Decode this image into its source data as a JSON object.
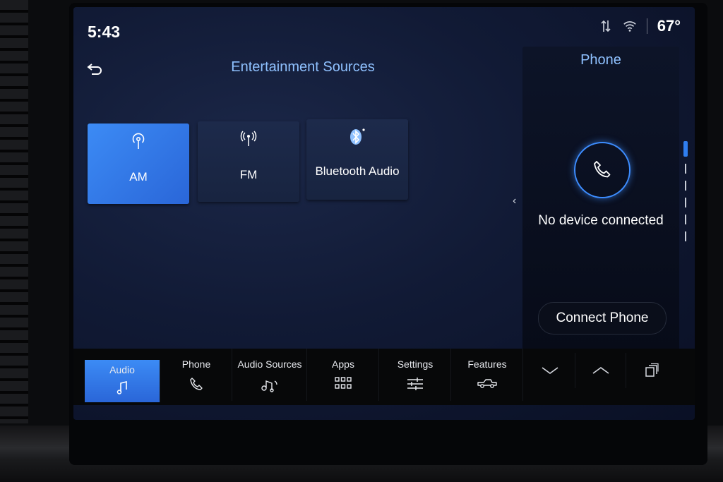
{
  "status": {
    "time": "5:43",
    "temperature": "67°"
  },
  "header": {
    "title": "Entertainment Sources"
  },
  "sources": [
    {
      "label": "AM",
      "icon": "antenna-icon",
      "selected": true
    },
    {
      "label": "FM",
      "icon": "radio-signal-icon",
      "selected": false
    },
    {
      "label": "Bluetooth Audio",
      "icon": "bluetooth-icon",
      "selected": false
    }
  ],
  "phone_panel": {
    "title": "Phone",
    "message": "No device connected",
    "connect_label": "Connect Phone"
  },
  "nav": {
    "items": [
      {
        "label": "Audio",
        "icon": "music-note-icon",
        "active": true
      },
      {
        "label": "Phone",
        "icon": "phone-icon",
        "active": false
      },
      {
        "label": "Audio Sources",
        "icon": "audio-sources-icon",
        "active": false
      },
      {
        "label": "Apps",
        "icon": "apps-grid-icon",
        "active": false
      },
      {
        "label": "Settings",
        "icon": "sliders-icon",
        "active": false
      },
      {
        "label": "Features",
        "icon": "truck-icon",
        "active": false
      }
    ],
    "utilities": [
      "chevron-down-icon",
      "chevron-up-icon",
      "window-switch-icon"
    ]
  },
  "colors": {
    "accent": "#3c8bf5",
    "title_blue": "#8fc1ff",
    "ring": "#3d8dff"
  }
}
